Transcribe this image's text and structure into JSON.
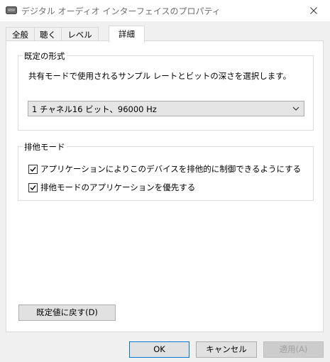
{
  "window": {
    "title": "デジタル オーディオ インターフェイスのプロパティ"
  },
  "tabs": [
    {
      "label": "全般"
    },
    {
      "label": "聴く"
    },
    {
      "label": "レベル"
    },
    {
      "label": "詳細"
    }
  ],
  "default_format": {
    "group_label": "既定の形式",
    "description": "共有モードで使用されるサンプル レートとビットの深さを選択します。",
    "selected": "1 チャネル16 ビット、96000 Hz"
  },
  "exclusive_mode": {
    "group_label": "排他モード",
    "options": [
      {
        "label": "アプリケーションによりこのデバイスを排他的に制御できるようにする",
        "checked": true
      },
      {
        "label": "排他モードのアプリケーションを優先する",
        "checked": true
      }
    ]
  },
  "buttons": {
    "restore_defaults": "既定値に戻す(D)",
    "ok": "OK",
    "cancel": "キャンセル",
    "apply": "適用(A)"
  },
  "colors": {
    "focus_border": "#0078d7",
    "disabled_text": "#a0a0a0"
  }
}
